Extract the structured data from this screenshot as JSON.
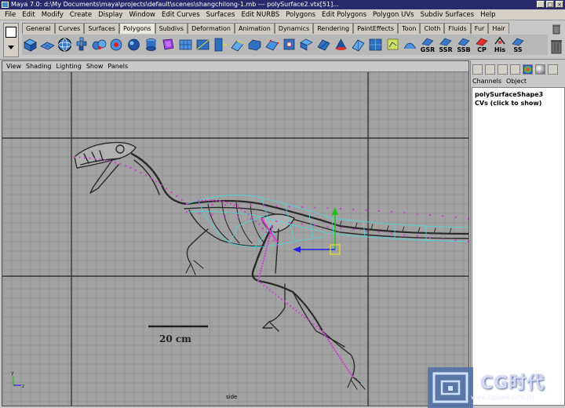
{
  "window": {
    "title": "Maya 7.0: d:\\My Documents\\maya\\projects\\default\\scenes\\shangchilong-1.mb   ---   polySurface2.vtx[51]..."
  },
  "menubar": [
    "File",
    "Edit",
    "Modify",
    "Create",
    "Display",
    "Window",
    "Edit Curves",
    "Surfaces",
    "Edit NURBS",
    "Polygons",
    "Edit Polygons",
    "Polygon UVs",
    "Subdiv Surfaces",
    "Help"
  ],
  "shelf": {
    "tabs": [
      "General",
      "Curves",
      "Surfaces",
      "Polygons",
      "Subdivs",
      "Deformation",
      "Animation",
      "Dynamics",
      "Rendering",
      "PaintEffects",
      "Toon",
      "Cloth",
      "Fluids",
      "Fur",
      "Hair"
    ],
    "active_tab": "Polygons",
    "text_icons": [
      "GSR",
      "SSR",
      "SSB",
      "CP",
      "His",
      "SS"
    ]
  },
  "viewport": {
    "menu": [
      "View",
      "Shading",
      "Lighting",
      "Show",
      "Panels"
    ],
    "view_label": "side",
    "scale_label": "20 cm",
    "axis_labels": [
      "y",
      "z"
    ]
  },
  "channel_box": {
    "tabs": [
      "Channels",
      "Object"
    ],
    "shape_name": "polySurfaceShape3",
    "cvs_label": "CVs (click to show)"
  },
  "watermark": {
    "brand": "CG时代",
    "url": "www.cgtime.com.cn"
  },
  "colors": {
    "title_bar": "#2a2a6a",
    "viewport_bg": "#a0a0a0",
    "grid_line": "#8a8a8a",
    "grid_axis": "#202020",
    "vertex": "#d040d0",
    "selection": "#40e0e0",
    "manip_blue": "#2020e0",
    "manip_green": "#20c020"
  }
}
